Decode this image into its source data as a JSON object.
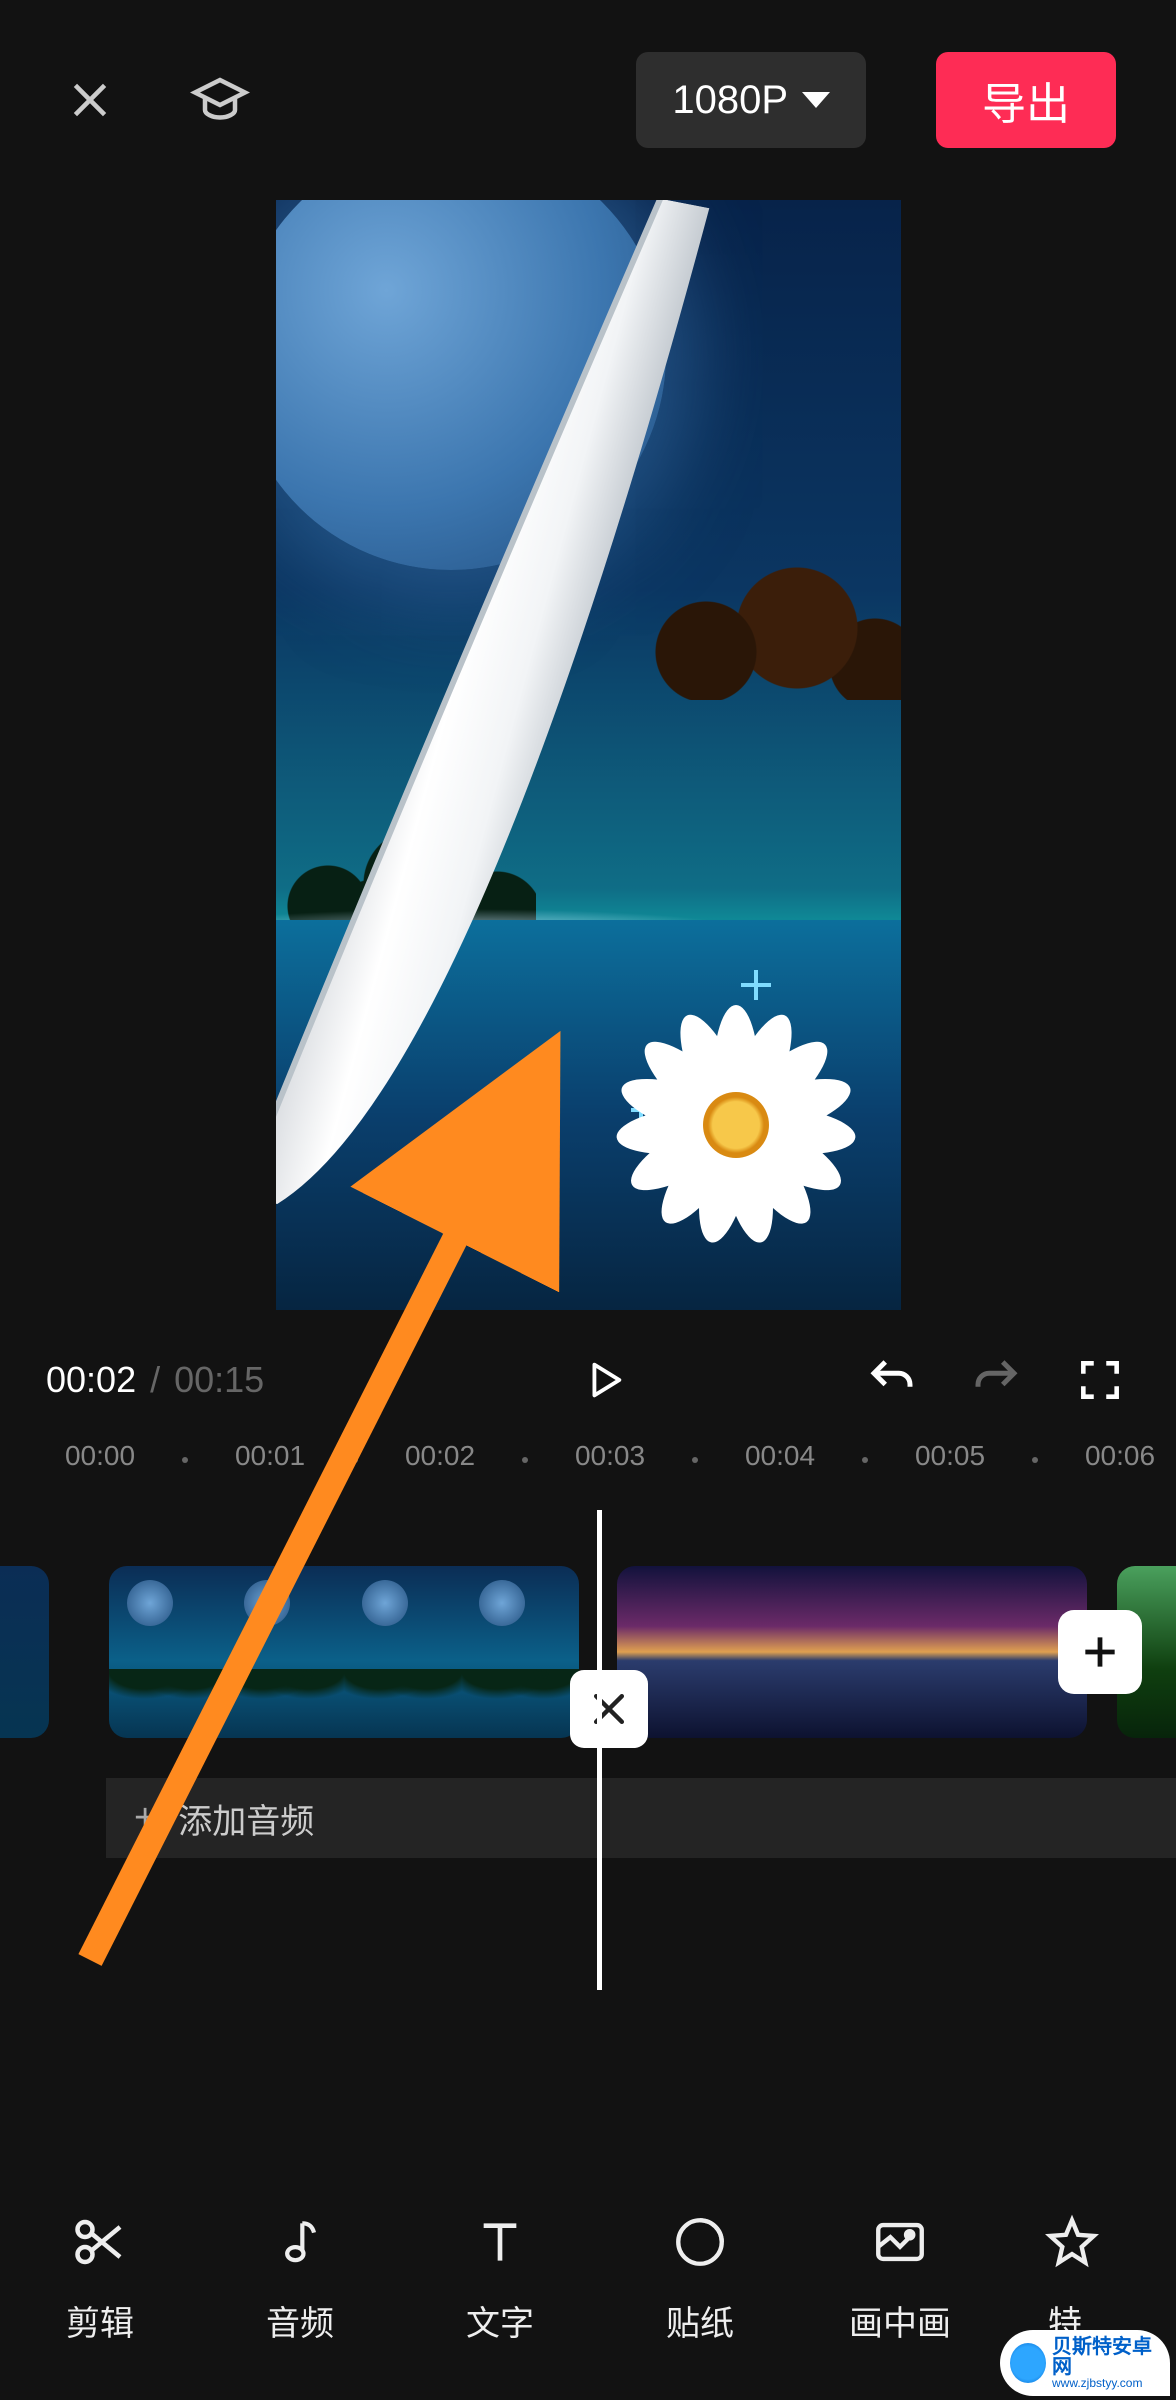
{
  "header": {
    "resolution_label": "1080P",
    "export_label": "导出"
  },
  "player": {
    "current_time": "00:02",
    "separator": "/",
    "total_time": "00:15"
  },
  "ruler": {
    "ticks": [
      "00:00",
      "00:01",
      "00:02",
      "00:03",
      "00:04",
      "00:05",
      "00:06"
    ]
  },
  "timeline": {
    "add_audio_label": "添加音频"
  },
  "toolbar": {
    "items": [
      {
        "id": "edit",
        "label": "剪辑"
      },
      {
        "id": "audio",
        "label": "音频"
      },
      {
        "id": "text",
        "label": "文字"
      },
      {
        "id": "sticker",
        "label": "贴纸"
      },
      {
        "id": "pip",
        "label": "画中画"
      },
      {
        "id": "effect",
        "label": "特"
      }
    ]
  },
  "watermark": {
    "line1": "贝斯特安卓网",
    "line2": "www.zjbstyy.com"
  }
}
